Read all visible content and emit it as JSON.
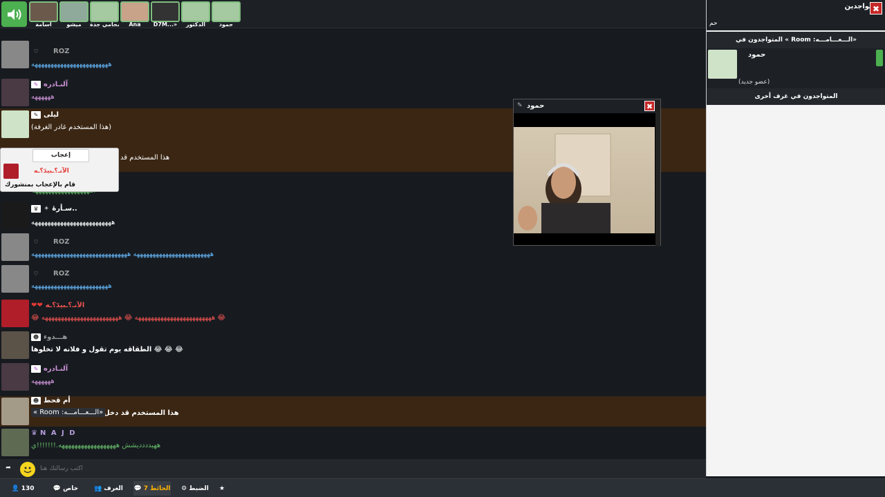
{
  "top_cams": [
    "حمود",
    "الدكتور",
    "D7M...»",
    "Ana",
    "محامي جدة",
    "ميشو",
    "اسامة"
  ],
  "chat": [
    {
      "name": "ROZ",
      "text": "ههههههههههههههههههههههههه",
      "ncolor": "#9e9e9e",
      "tcolor": "#64b5f6",
      "hl": false
    },
    {
      "name": "آلنـادره",
      "text": "ههههههه",
      "ncolor": "#ce93d8",
      "tcolor": "#ce93d8",
      "hl": false
    },
    {
      "name": "ليلى",
      "text": "(هذا المستخدم غادر الغرفة)",
      "ncolor": "#fff",
      "tcolor": "#fff",
      "hl": true
    },
    {
      "name": "",
      "text": "هذا المستخدم قد",
      "ncolor": "#fff",
      "tcolor": "#fff",
      "hl": true
    },
    {
      "name": "",
      "text": "ههههههههههههههههههه.",
      "ncolor": "#fff",
      "tcolor": "#66bb6a",
      "hl": false
    },
    {
      "name": "سـأرهٔ..",
      "text": "هههههههههههههههههههههههههه",
      "ncolor": "#fff",
      "tcolor": "#fff",
      "hl": false
    },
    {
      "name": "ROZ",
      "text": "ههههههههههههههههههههههههه ههههههههههههههههههههههههههههههه",
      "ncolor": "#9e9e9e",
      "tcolor": "#64b5f6",
      "hl": false
    },
    {
      "name": "ROZ",
      "text": "ههههههههههههههههههههههههه",
      "ncolor": "#9e9e9e",
      "tcolor": "#64b5f6",
      "hl": false
    },
    {
      "name": "الآنـ؟ـبيدٓ؟ـه",
      "text": "😂 ههههههههههههههههههههههههه 😂 ههههههههههههههههههههههههه 😂",
      "ncolor": "#ef5350",
      "tcolor": "#ef5350",
      "hl": false
    },
    {
      "name": "هـــدوء",
      "text": "الطقاقه يوم تقول و فلانه لا تخلوها 😂 😂 😂",
      "ncolor": "#9e9e9e",
      "tcolor": "#fff",
      "hl": false
    },
    {
      "name": "آلنـادره",
      "text": "ههههههه",
      "ncolor": "#ce93d8",
      "tcolor": "#ce93d8",
      "hl": false
    },
    {
      "name": "أم قحط",
      "text": "هذا المستخدم قد دخل",
      "room": "« Room :الـــعـــامـــه»",
      "ncolor": "#fff",
      "tcolor": "#fff",
      "hl": true
    },
    {
      "name": "N A J D",
      "text": "ههيدددديشش ههههههههههههههههههه.!!!!!!!ي",
      "ncolor": "#b39ddb",
      "tcolor": "#66bb6a",
      "hl": false
    }
  ],
  "like_popup": {
    "button": "إعجاب",
    "name": "الآنـ؟ـبيدٓ؟ـه",
    "text": "قام بالإعجاب بمنشورك"
  },
  "input": {
    "placeholder": "اكتب رسالتك هنا"
  },
  "nav": {
    "count": "130",
    "private": "خاص",
    "rooms": "الغرف",
    "wall": "الحائط",
    "wall_count": "7",
    "settings": "الضبط"
  },
  "panel": {
    "title": "المتواجدين",
    "search": "حم",
    "room_section": "المتواجدون في « Room :الـــعـــامـــه»",
    "user_name": "حمود",
    "user_status": "(عضو جديد)",
    "other_section": "المتواجدون في غرف أخرى"
  },
  "video": {
    "title": "حمود"
  }
}
